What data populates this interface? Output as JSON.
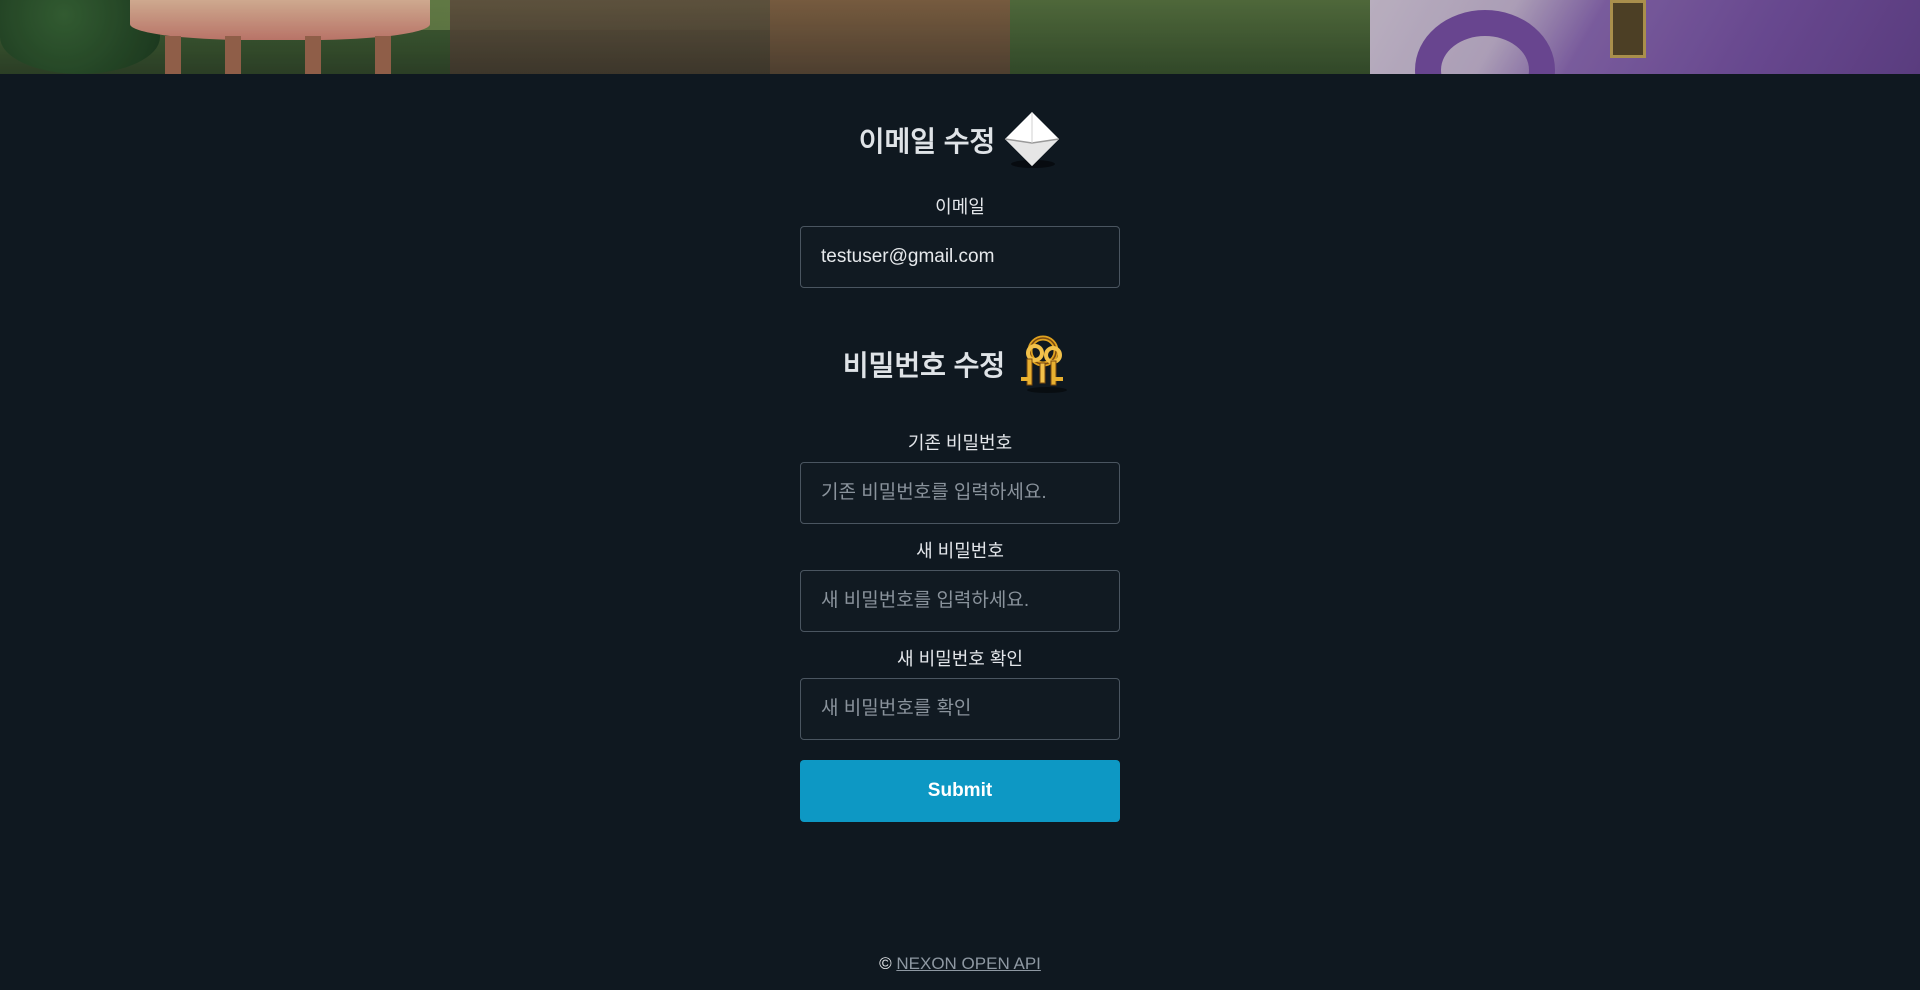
{
  "email_section": {
    "title": "이메일 수정",
    "icon": "envelope-icon",
    "label": "이메일",
    "value": "testuser@gmail.com"
  },
  "password_section": {
    "title": "비밀번호 수정",
    "icon": "keys-icon",
    "current": {
      "label": "기존 비밀번호",
      "placeholder": "기존 비밀번호를 입력하세요."
    },
    "new": {
      "label": "새 비밀번호",
      "placeholder": "새 비밀번호를 입력하세요."
    },
    "confirm": {
      "label": "새 비밀번호 확인",
      "placeholder": "새 비밀번호를 확인"
    }
  },
  "submit_label": "Submit",
  "footer": {
    "copyright_symbol": "©",
    "link_text": "NEXON OPEN API"
  },
  "colors": {
    "background": "#0f1820",
    "accent": "#0d98c4"
  }
}
